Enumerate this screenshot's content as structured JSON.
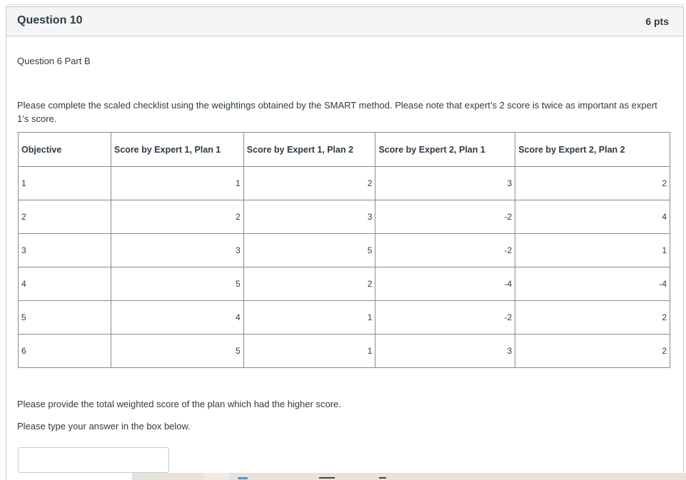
{
  "question": {
    "title": "Question 10",
    "points": "6 pts",
    "part": "Question 6 Part B",
    "instructions": "Please complete the scaled checklist using the weightings obtained by the SMART method. Please note that expert’s 2 score is twice as important as expert 1’s score.",
    "final_prompt": "Please provide the total weighted score of the plan which had the higher score.",
    "type_prompt": "Please type your answer in the box below.",
    "answer_value": ""
  },
  "table": {
    "headers": [
      "Objective",
      "Score by Expert 1, Plan 1",
      "Score by Expert 1, Plan 2",
      "Score by Expert 2, Plan 1",
      "Score by Expert 2, Plan 2"
    ],
    "rows": [
      [
        "1",
        "1",
        "2",
        "3",
        "2"
      ],
      [
        "2",
        "2",
        "3",
        "-2",
        "4"
      ],
      [
        "3",
        "3",
        "5",
        "-2",
        "1"
      ],
      [
        "4",
        "5",
        "2",
        "-4",
        "-4"
      ],
      [
        "5",
        "4",
        "1",
        "-2",
        "2"
      ],
      [
        "6",
        "5",
        "1",
        "3",
        "2"
      ]
    ]
  }
}
